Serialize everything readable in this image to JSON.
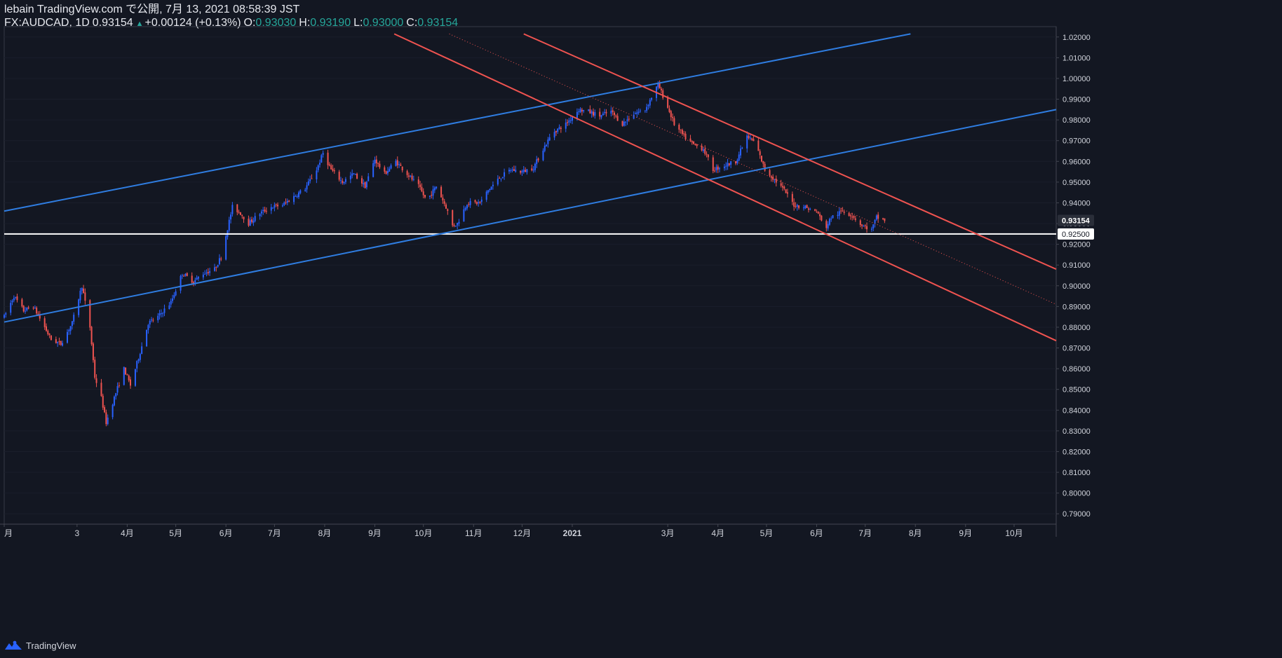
{
  "header": {
    "publisher": "lebain TradingView.com で公開, 7月 13, 2021 08:58:39 JST",
    "symbol": "FX:AUDCAD, 1D",
    "last": "0.93154",
    "change": "+0.00124 (+0.13%)",
    "o_label": "O:",
    "o_value": "0.93030",
    "h_label": "H:",
    "h_value": "0.93190",
    "l_label": "L:",
    "l_value": "0.93000",
    "c_label": "C:",
    "c_value": "0.93154"
  },
  "footer": {
    "brand": "TradingView"
  },
  "colors": {
    "background": "#131722",
    "up": "#2962ff",
    "down": "#ef5350",
    "channel_blue": "#2f7de1",
    "channel_red": "#ef5350",
    "support": "#ffffff",
    "text": "#d1d4dc"
  },
  "chart_data": {
    "type": "candlestick",
    "symbol": "FX:AUDCAD",
    "interval": "1D",
    "ylim": [
      0.785,
      1.025
    ],
    "y_ticks": [
      "1.02000",
      "1.01000",
      "1.00000",
      "0.99000",
      "0.98000",
      "0.97000",
      "0.96000",
      "0.95000",
      "0.94000",
      "0.93000",
      "0.92000",
      "0.91000",
      "0.90000",
      "0.89000",
      "0.88000",
      "0.87000",
      "0.86000",
      "0.85000",
      "0.84000",
      "0.83000",
      "0.82000",
      "0.81000",
      "0.80000",
      "0.79000"
    ],
    "x_ticks": [
      "月",
      "3",
      "4月",
      "5月",
      "6月",
      "7月",
      "8月",
      "9月",
      "10月",
      "11月",
      "12月",
      "2021",
      "3月",
      "4月",
      "5月",
      "6月",
      "7月",
      "8月",
      "9月",
      "10月"
    ],
    "x_range": [
      "2020-01-16",
      "2021-10-27"
    ],
    "x_tick_dates": [
      "2020-01-16",
      "2020-03-01",
      "2020-04-01",
      "2020-05-01",
      "2020-06-01",
      "2020-07-01",
      "2020-08-01",
      "2020-09-01",
      "2020-10-01",
      "2020-11-01",
      "2020-12-01",
      "2021-01-01",
      "2021-03-01",
      "2021-04-01",
      "2021-05-01",
      "2021-06-01",
      "2021-07-01",
      "2021-08-01",
      "2021-09-01",
      "2021-10-01"
    ],
    "price_labels": [
      {
        "value": "0.93154",
        "kind": "last"
      },
      {
        "value": "0.92500",
        "kind": "support"
      }
    ],
    "support_level": 0.925,
    "trendlines": [
      {
        "name": "upper-blue",
        "color": "blue",
        "from": [
          "2020-01-16",
          0.936
        ],
        "to": [
          "2021-07-29",
          1.0215
        ]
      },
      {
        "name": "lower-blue",
        "color": "blue",
        "from": [
          "2020-01-16",
          0.8825
        ],
        "to": [
          "2021-10-27",
          0.985
        ]
      },
      {
        "name": "upper-red",
        "color": "red",
        "from": [
          "2020-12-02",
          1.0215
        ],
        "to": [
          "2021-10-27",
          0.908
        ]
      },
      {
        "name": "lower-red",
        "color": "red",
        "from": [
          "2020-09-13",
          1.0215
        ],
        "to": [
          "2021-10-27",
          0.8735
        ]
      },
      {
        "name": "mid-red-dotted",
        "color": "red",
        "dotted": true,
        "from": [
          "2020-10-17",
          1.0215
        ],
        "to": [
          "2021-10-27",
          0.891
        ]
      }
    ],
    "price_path": [
      [
        "2020-01-16",
        0.885
      ],
      [
        "2020-01-22",
        0.895
      ],
      [
        "2020-01-28",
        0.888
      ],
      [
        "2020-02-03",
        0.89
      ],
      [
        "2020-02-10",
        0.88
      ],
      [
        "2020-02-14",
        0.874
      ],
      [
        "2020-02-20",
        0.872
      ],
      [
        "2020-02-27",
        0.882
      ],
      [
        "2020-03-04",
        0.9
      ],
      [
        "2020-03-09",
        0.88
      ],
      [
        "2020-03-12",
        0.856
      ],
      [
        "2020-03-16",
        0.846
      ],
      [
        "2020-03-19",
        0.834
      ],
      [
        "2020-03-24",
        0.846
      ],
      [
        "2020-03-30",
        0.86
      ],
      [
        "2020-04-03",
        0.852
      ],
      [
        "2020-04-09",
        0.868
      ],
      [
        "2020-04-14",
        0.882
      ],
      [
        "2020-04-20",
        0.885
      ],
      [
        "2020-04-28",
        0.892
      ],
      [
        "2020-05-05",
        0.906
      ],
      [
        "2020-05-12",
        0.902
      ],
      [
        "2020-05-18",
        0.906
      ],
      [
        "2020-05-25",
        0.908
      ],
      [
        "2020-05-29",
        0.914
      ],
      [
        "2020-06-05",
        0.938
      ],
      [
        "2020-06-10",
        0.935
      ],
      [
        "2020-06-15",
        0.93
      ],
      [
        "2020-06-22",
        0.935
      ],
      [
        "2020-06-29",
        0.938
      ],
      [
        "2020-07-06",
        0.939
      ],
      [
        "2020-07-13",
        0.943
      ],
      [
        "2020-07-20",
        0.947
      ],
      [
        "2020-07-27",
        0.956
      ],
      [
        "2020-07-31",
        0.964
      ],
      [
        "2020-08-05",
        0.956
      ],
      [
        "2020-08-12",
        0.95
      ],
      [
        "2020-08-19",
        0.954
      ],
      [
        "2020-08-26",
        0.948
      ],
      [
        "2020-09-01",
        0.961
      ],
      [
        "2020-09-07",
        0.954
      ],
      [
        "2020-09-14",
        0.96
      ],
      [
        "2020-09-21",
        0.954
      ],
      [
        "2020-09-28",
        0.948
      ],
      [
        "2020-10-03",
        0.941
      ],
      [
        "2020-10-09",
        0.948
      ],
      [
        "2020-10-15",
        0.938
      ],
      [
        "2020-10-19",
        0.929
      ],
      [
        "2020-10-22",
        0.93
      ],
      [
        "2020-10-28",
        0.94
      ],
      [
        "2020-11-05",
        0.94
      ],
      [
        "2020-11-10",
        0.946
      ],
      [
        "2020-11-17",
        0.952
      ],
      [
        "2020-11-24",
        0.956
      ],
      [
        "2020-12-01",
        0.955
      ],
      [
        "2020-12-08",
        0.957
      ],
      [
        "2020-12-14",
        0.966
      ],
      [
        "2020-12-20",
        0.974
      ],
      [
        "2020-12-28",
        0.978
      ],
      [
        "2021-01-05",
        0.985
      ],
      [
        "2021-01-11",
        0.984
      ],
      [
        "2021-01-18",
        0.982
      ],
      [
        "2021-01-25",
        0.984
      ],
      [
        "2021-02-01",
        0.978
      ],
      [
        "2021-02-08",
        0.983
      ],
      [
        "2021-02-15",
        0.985
      ],
      [
        "2021-02-23",
        0.997
      ],
      [
        "2021-02-28",
        0.988
      ],
      [
        "2021-03-05",
        0.978
      ],
      [
        "2021-03-11",
        0.972
      ],
      [
        "2021-03-17",
        0.968
      ],
      [
        "2021-03-23",
        0.966
      ],
      [
        "2021-03-29",
        0.956
      ],
      [
        "2021-04-05",
        0.958
      ],
      [
        "2021-04-12",
        0.96
      ],
      [
        "2021-04-19",
        0.972
      ],
      [
        "2021-04-24",
        0.969
      ],
      [
        "2021-04-30",
        0.956
      ],
      [
        "2021-05-05",
        0.952
      ],
      [
        "2021-05-12",
        0.946
      ],
      [
        "2021-05-18",
        0.939
      ],
      [
        "2021-05-25",
        0.938
      ],
      [
        "2021-06-02",
        0.935
      ],
      [
        "2021-06-06",
        0.927
      ],
      [
        "2021-06-10",
        0.933
      ],
      [
        "2021-06-17",
        0.936
      ],
      [
        "2021-06-23",
        0.934
      ],
      [
        "2021-06-29",
        0.929
      ],
      [
        "2021-07-05",
        0.927
      ],
      [
        "2021-07-08",
        0.933
      ],
      [
        "2021-07-13",
        0.93154
      ]
    ]
  }
}
